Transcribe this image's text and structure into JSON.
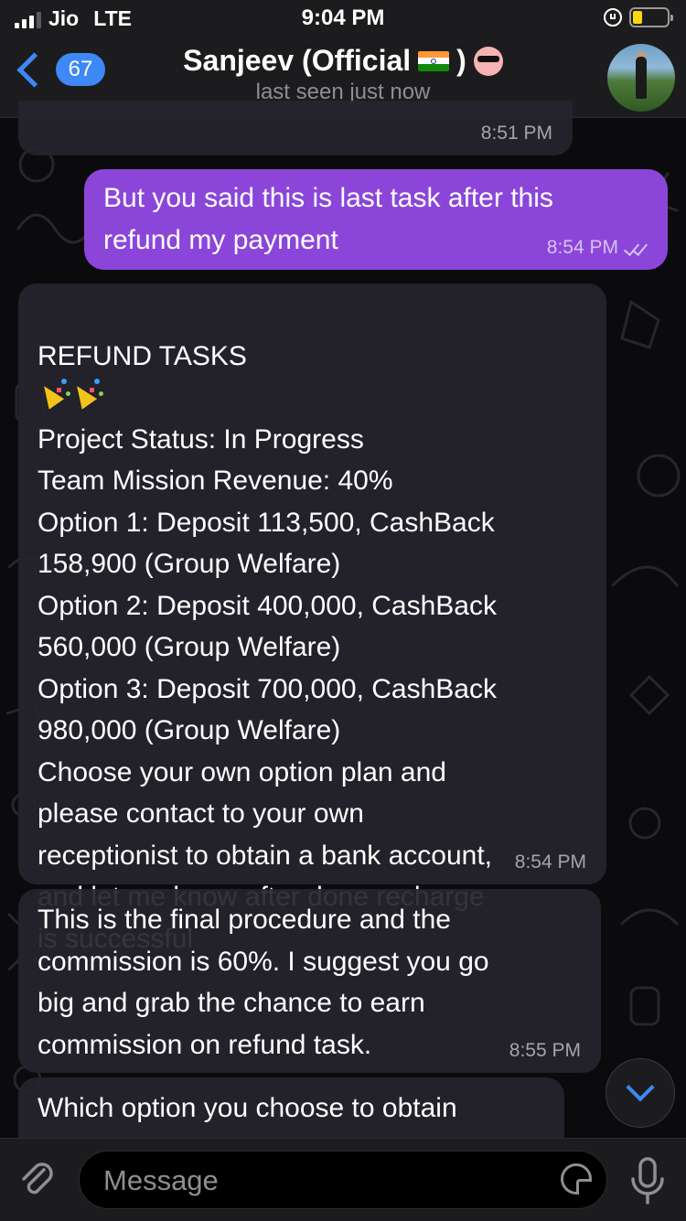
{
  "status_bar": {
    "carrier": "Jio",
    "network": "LTE",
    "time": "9:04 PM"
  },
  "header": {
    "back_count": "67",
    "contact_name": "Sanjeev (Official",
    "contact_name_suffix": ")",
    "status": "last seen just now"
  },
  "messages": [
    {
      "direction": "incoming",
      "text": "",
      "time": "8:51 PM"
    },
    {
      "direction": "outgoing",
      "text": "But you said this is last task after this\nrefund my payment",
      "time": "8:54 PM",
      "read": true
    },
    {
      "direction": "incoming",
      "title": "REFUND TASKS",
      "text": "Project Status: In Progress\nTeam Mission Revenue: 40%\nOption 1: Deposit 113,500, CashBack\n158,900 (Group Welfare)\nOption 2: Deposit 400,000, CashBack\n560,000 (Group Welfare)\nOption 3: Deposit 700,000, CashBack\n980,000 (Group Welfare)\nChoose your own option plan and\nplease contact to your own\nreceptionist to obtain a bank account,\nand let me know after done recharge\nis successful",
      "time": "8:54 PM"
    },
    {
      "direction": "incoming",
      "text": "This is the final procedure and the\ncommission is 60%. I suggest you go\nbig and grab the chance to earn\ncommission on refund task.",
      "time": "8:55 PM"
    },
    {
      "direction": "incoming",
      "text": "Which option you choose to obtain",
      "time": ""
    }
  ],
  "input": {
    "placeholder": "Message"
  },
  "colors": {
    "accent": "#3e88f7",
    "outgoing_bubble": "#8b46d9",
    "incoming_bubble": "#26242c",
    "background": "#0b0b0d"
  },
  "icons": [
    "signal-icon",
    "lock-rotation-icon",
    "battery-icon",
    "back-chevron-icon",
    "india-flag-icon",
    "sunglasses-emoji-icon",
    "party-popper-icon",
    "double-check-icon",
    "scroll-down-icon",
    "attach-icon",
    "sticker-icon",
    "microphone-icon"
  ]
}
